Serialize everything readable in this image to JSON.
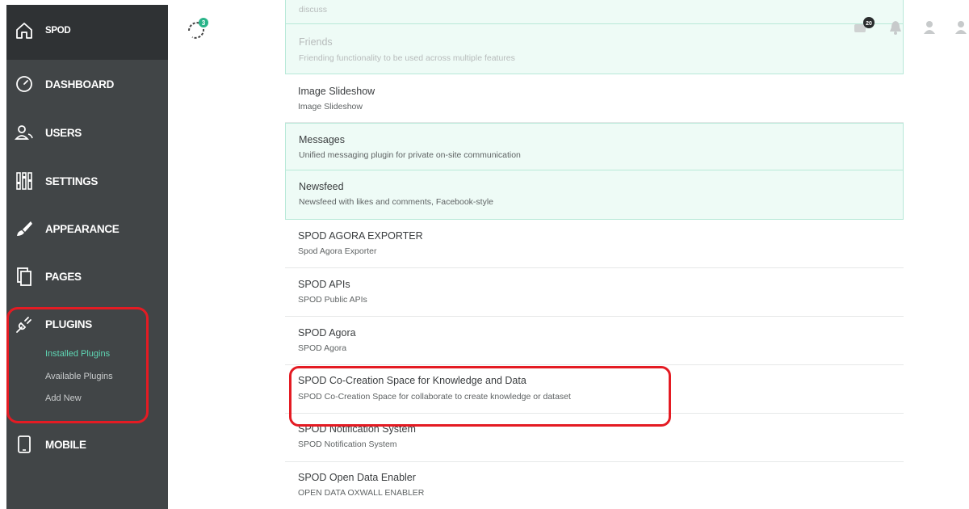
{
  "sidebar": {
    "brand": "SPOD",
    "items": [
      {
        "label": "DASHBOARD",
        "icon": "dashboard-icon"
      },
      {
        "label": "USERS",
        "icon": "users-icon"
      },
      {
        "label": "SETTINGS",
        "icon": "settings-icon"
      },
      {
        "label": "APPEARANCE",
        "icon": "appearance-icon"
      },
      {
        "label": "PAGES",
        "icon": "pages-icon"
      },
      {
        "label": "PLUGINS",
        "icon": "plug-icon"
      },
      {
        "label": "MOBILE",
        "icon": "mobile-icon"
      }
    ],
    "plugins_sub": [
      {
        "label": "Installed Plugins",
        "active": true
      },
      {
        "label": "Available Plugins",
        "active": false
      },
      {
        "label": "Add New",
        "active": false
      }
    ]
  },
  "header": {
    "sync_badge": "3",
    "messages_badge": "20"
  },
  "plugins": [
    {
      "title": "",
      "desc": "discuss",
      "enabled": true
    },
    {
      "title": "Friends",
      "desc": "Friending functionality to be used across multiple features",
      "enabled": true
    },
    {
      "title": "Image Slideshow",
      "desc": "Image Slideshow",
      "enabled": false
    },
    {
      "title": "Messages",
      "desc": "Unified messaging plugin for private on-site communication",
      "enabled": true
    },
    {
      "title": "Newsfeed",
      "desc": "Newsfeed with likes and comments, Facebook-style",
      "enabled": true
    },
    {
      "title": "SPOD AGORA EXPORTER",
      "desc": "Spod Agora Exporter",
      "enabled": false
    },
    {
      "title": "SPOD APIs",
      "desc": "SPOD Public APIs",
      "enabled": false
    },
    {
      "title": "SPOD Agora",
      "desc": "SPOD Agora",
      "enabled": false
    },
    {
      "title": "SPOD Co-Creation Space for Knowledge and Data",
      "desc": "SPOD Co-Creation Space for collaborate to create knowledge or dataset",
      "enabled": false
    },
    {
      "title": "SPOD Notification System",
      "desc": "SPOD Notification System",
      "enabled": false
    },
    {
      "title": "SPOD Open Data Enabler",
      "desc": "OPEN DATA OXWALL ENABLER",
      "enabled": false
    }
  ],
  "colors": {
    "sidebar_bg": "#414547",
    "accent": "#5fd6b4",
    "highlight": "#e41b23",
    "enabled_bg": "#eefbf6"
  }
}
